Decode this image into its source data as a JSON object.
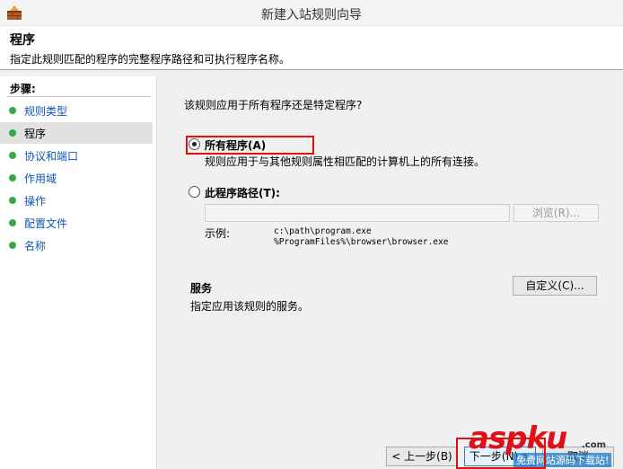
{
  "window": {
    "title": "新建入站规则向导"
  },
  "header": {
    "title": "程序",
    "description": "指定此规则匹配的程序的完整程序路径和可执行程序名称。"
  },
  "sidebar": {
    "steps_label": "步骤:",
    "items": [
      {
        "label": "规则类型"
      },
      {
        "label": "程序"
      },
      {
        "label": "协议和端口"
      },
      {
        "label": "作用域"
      },
      {
        "label": "操作"
      },
      {
        "label": "配置文件"
      },
      {
        "label": "名称"
      }
    ]
  },
  "main": {
    "question": "该规则应用于所有程序还是特定程序?",
    "all_programs": {
      "label": "所有程序(A)",
      "description": "规则应用于与其他规则属性相匹配的计算机上的所有连接。",
      "selected": true
    },
    "this_program": {
      "label": "此程序路径(T):",
      "path_value": "",
      "browse_label": "浏览(R)...",
      "example_label": "示例:",
      "example_line1": "c:\\path\\program.exe",
      "example_line2": "%ProgramFiles%\\browser\\browser.exe",
      "selected": false
    },
    "services": {
      "title": "服务",
      "description": "指定应用该规则的服务。",
      "button_label": "自定义(C)..."
    }
  },
  "footer": {
    "back_label": "< 上一步(B)",
    "next_label": "下一步(N) >",
    "cancel_label": "取消"
  },
  "watermark": {
    "main": "aspku",
    "com": ".com",
    "sub": "免费网站源码下载站!"
  },
  "colors": {
    "link": "#0f56b4",
    "step_dot": "#37a84a",
    "highlight": "#e01010"
  }
}
